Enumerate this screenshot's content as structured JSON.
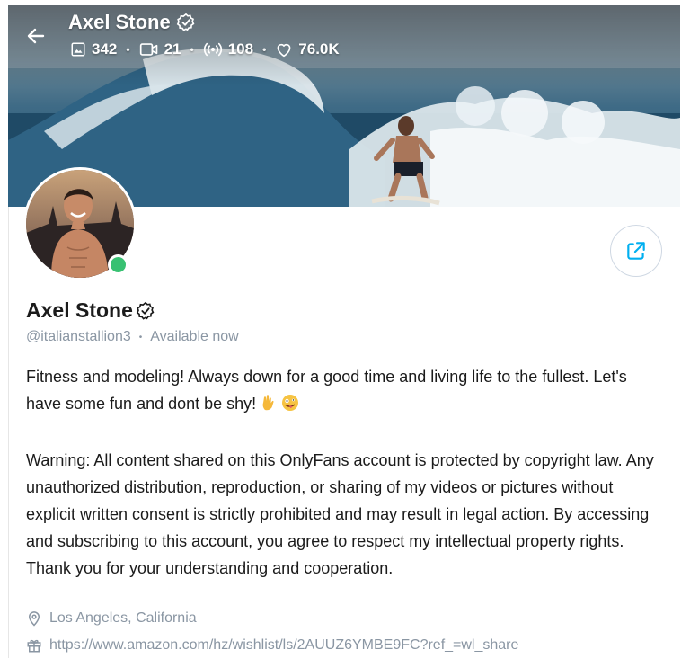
{
  "header": {
    "name": "Axel Stone",
    "stats": {
      "photos": "342",
      "videos": "21",
      "streams": "108",
      "likes": "76.0K"
    }
  },
  "profile": {
    "name": "Axel Stone",
    "handle": "@italianstallion3",
    "status": "Available now",
    "bio_line1": "Fitness and modeling! Always down for a good time and living life to the fullest. Let's have some fun and dont be shy!",
    "bio_warning": "Warning: All content shared on this OnlyFans account is protected by copyright law. Any unauthorized distribution, reproduction, or sharing of my videos or pictures without explicit written consent is strictly prohibited and may result in legal action. By accessing and subscribing to this account, you agree to respect my intellectual property rights. Thank you for your understanding and cooperation.",
    "location": "Los Angeles, California",
    "wishlist_url": "https://www.amazon.com/hz/wishlist/ls/2AUUZ6YMBE9FC?ref_=wl_share"
  },
  "colors": {
    "accent": "#00aff0",
    "muted": "#8a96a3",
    "online": "#38c172"
  },
  "icons": [
    "back-arrow-icon",
    "verified-icon",
    "photo-icon",
    "video-icon",
    "stream-icon",
    "heart-icon",
    "share-icon",
    "location-pin-icon",
    "gift-icon"
  ]
}
